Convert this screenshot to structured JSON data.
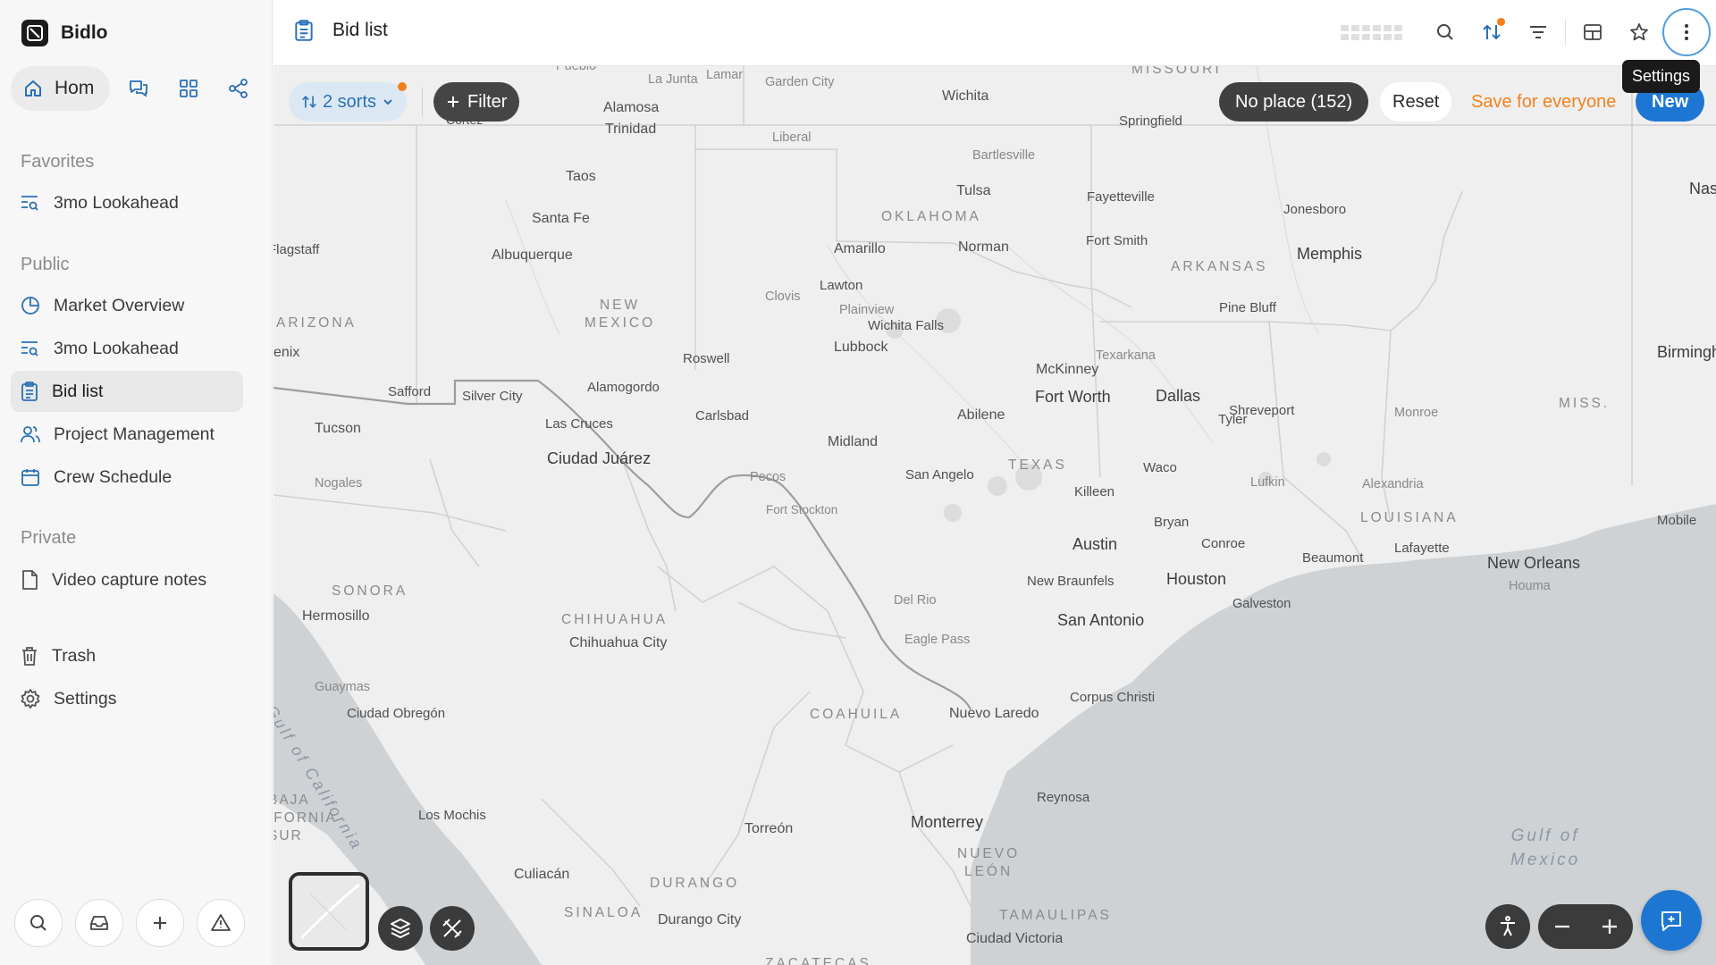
{
  "app": {
    "name": "Bidlo"
  },
  "sidebar": {
    "home_label": "Hom",
    "sections": {
      "favorites": "Favorites",
      "public": "Public",
      "private": "Private"
    },
    "favorites": [
      {
        "label": "3mo Lookahead",
        "icon": "list-search-icon"
      }
    ],
    "public": [
      {
        "label": "Market Overview",
        "icon": "pie-chart-icon"
      },
      {
        "label": "3mo Lookahead",
        "icon": "list-search-icon"
      },
      {
        "label": "Bid list",
        "icon": "clipboard-icon",
        "active": true
      },
      {
        "label": "Project Management",
        "icon": "users-icon"
      },
      {
        "label": "Crew Schedule",
        "icon": "calendar-icon"
      }
    ],
    "private": [
      {
        "label": "Video capture notes",
        "icon": "file-icon"
      }
    ],
    "footer": [
      {
        "label": "Trash",
        "icon": "trash-icon"
      },
      {
        "label": "Settings",
        "icon": "gear-icon"
      }
    ]
  },
  "header": {
    "title": "Bid list",
    "tooltip": "Settings"
  },
  "toolbar": {
    "sorts_label": "2 sorts",
    "filter_label": "Filter",
    "no_place_label": "No place (152)",
    "reset_label": "Reset",
    "save_label": "Save for everyone",
    "new_label": "New"
  },
  "colors": {
    "accent": "#1d76d2",
    "warning": "#f2811d",
    "sorts_bg": "#dbe8f4"
  },
  "map": {
    "labels": {
      "pueblo": "Pueblo",
      "lajunta": "La Junta",
      "lamar": "Lamar",
      "gardencity": "Garden City",
      "wichita": "Wichita",
      "missouri": "MISSOURI",
      "springfield": "Springfield",
      "alamosa": "Alamosa",
      "trinidad": "Trinidad",
      "liberal": "Liberal",
      "cortez": "Cortez",
      "bartlesville": "Bartlesville",
      "tulsa": "Tulsa",
      "fayetteville": "Fayetteville",
      "jonesboro": "Jonesboro",
      "nashville": "Nas",
      "taos": "Taos",
      "santafe": "Santa Fe",
      "oklahoma": "OKLAHOMA",
      "flagstaff": "Flagstaff",
      "albuquerque": "Albuquerque",
      "amarillo": "Amarillo",
      "norman": "Norman",
      "fortsmith": "Fort Smith",
      "arkansas": "ARKANSAS",
      "memphis": "Memphis",
      "newmexico": "NEW\nMEXICO",
      "clovis": "Clovis",
      "lawton": "Lawton",
      "plainview": "Plainview",
      "arizona": "ARIZONA",
      "wichitafalls": "Wichita Falls",
      "pinebluff": "Pine Bluff",
      "phoenix": "enix",
      "lubbock": "Lubbock",
      "texarkana": "Texarkana",
      "birmingham": "Birmingham",
      "roswell": "Roswell",
      "mckinney": "McKinney",
      "safford": "Safford",
      "silvercity": "Silver City",
      "alamogordo": "Alamogordo",
      "fortworth": "Fort Worth",
      "dallas": "Dallas",
      "shreveport": "Shreveport",
      "monroe": "Monroe",
      "miss": "MISS.",
      "abilene": "Abilene",
      "tyler": "Tyler",
      "lascruces": "Las Cruces",
      "carlsbad": "Carlsbad",
      "tucson": "Tucson",
      "midland": "Midland",
      "ciudadjuarez": "Ciudad Juárez",
      "texas": "TEXAS",
      "sanangelo": "San Angelo",
      "waco": "Waco",
      "nogales": "Nogales",
      "pecos": "Pecos",
      "killeen": "Killeen",
      "lufkin": "Lufkin",
      "alexandria": "Alexandria",
      "fortstockton": "Fort Stockton",
      "louisiana": "LOUISIANA",
      "mobile": "Mobile",
      "bryan": "Bryan",
      "lafayette": "Lafayette",
      "austin": "Austin",
      "conroe": "Conroe",
      "beaumont": "Beaumont",
      "neworleans": "New Orleans",
      "houma": "Houma",
      "sonora": "SONORA",
      "newbraunfels": "New Braunfels",
      "houston": "Houston",
      "hermosillo": "Hermosillo",
      "delrio": "Del Rio",
      "galveston": "Galveston",
      "chihuahuastate": "CHIHUAHUA",
      "sanantonio": "San Antonio",
      "chihuahuacity": "Chihuahua City",
      "eaglepass": "Eagle Pass",
      "guaymas": "Guaymas",
      "corpuschristi": "Corpus Christi",
      "ciudadobregon": "Ciudad Obregón",
      "coahuila": "COAHUILA",
      "nuevolaredo": "Nuevo Laredo",
      "gulfcalifornia": "Gulf of California",
      "reynosa": "Reynosa",
      "bajacal": "BAJA\nIFORNIA\nSUR",
      "losmochis": "Los Mochis",
      "monterrey": "Monterrey",
      "torreon": "Torreón",
      "nuevoleon": "NUEVO\nLEÓN",
      "gulfmexico": "Gulf of\nMexico",
      "culiacan": "Culiacán",
      "durango": "DURANGO",
      "sinaloa": "SINALOA",
      "durangocity": "Durango City",
      "tamaulipas": "TAMAULIPAS",
      "ciudadvictoria": "Ciudad Victoria",
      "zacatecas": "ZACATECAS"
    }
  }
}
